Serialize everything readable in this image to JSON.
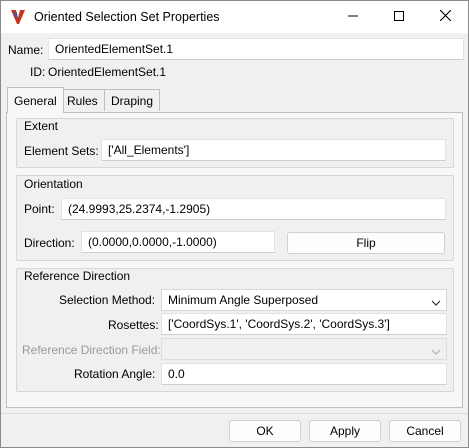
{
  "window": {
    "title": "Oriented Selection Set Properties",
    "icons": {
      "app": "app-logo-icon",
      "minimize": "minimize-icon",
      "maximize": "maximize-icon",
      "close": "close-icon"
    }
  },
  "header": {
    "name_label": "Name:",
    "name_value": "OrientedElementSet.1",
    "id_label": "ID:",
    "id_value": "OrientedElementSet.1"
  },
  "tabs": [
    {
      "label": "General",
      "active": true
    },
    {
      "label": "Rules",
      "active": false
    },
    {
      "label": "Draping",
      "active": false
    }
  ],
  "extent": {
    "title": "Extent",
    "element_sets_label": "Element Sets:",
    "element_sets_value": "['All_Elements']"
  },
  "orientation": {
    "title": "Orientation",
    "point_label": "Point:",
    "point_value": "(24.9993,25.2374,-1.2905)",
    "direction_label": "Direction:",
    "direction_value": "(0.0000,0.0000,-1.0000)",
    "flip_label": "Flip"
  },
  "reference_direction": {
    "title": "Reference Direction",
    "selection_method_label": "Selection Method:",
    "selection_method_value": "Minimum Angle Superposed",
    "rosettes_label": "Rosettes:",
    "rosettes_value": "['CoordSys.1', 'CoordSys.2', 'CoordSys.3']",
    "ref_dir_field_label": "Reference Direction Field:",
    "ref_dir_field_value": "",
    "rotation_angle_label": "Rotation Angle:",
    "rotation_angle_value": "0.0"
  },
  "footer": {
    "ok_label": "OK",
    "apply_label": "Apply",
    "cancel_label": "Cancel"
  }
}
